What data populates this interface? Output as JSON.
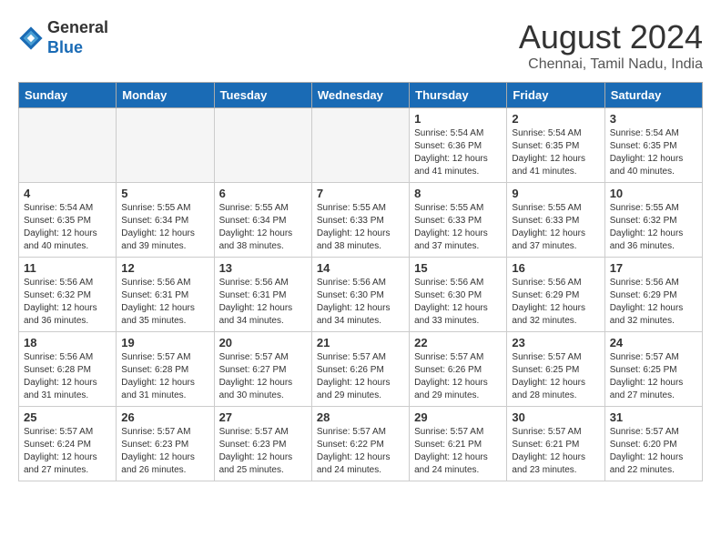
{
  "header": {
    "logo_line1": "General",
    "logo_line2": "Blue",
    "month_year": "August 2024",
    "location": "Chennai, Tamil Nadu, India"
  },
  "weekdays": [
    "Sunday",
    "Monday",
    "Tuesday",
    "Wednesday",
    "Thursday",
    "Friday",
    "Saturday"
  ],
  "weeks": [
    [
      {
        "day": "",
        "info": ""
      },
      {
        "day": "",
        "info": ""
      },
      {
        "day": "",
        "info": ""
      },
      {
        "day": "",
        "info": ""
      },
      {
        "day": "1",
        "info": "Sunrise: 5:54 AM\nSunset: 6:36 PM\nDaylight: 12 hours\nand 41 minutes."
      },
      {
        "day": "2",
        "info": "Sunrise: 5:54 AM\nSunset: 6:35 PM\nDaylight: 12 hours\nand 41 minutes."
      },
      {
        "day": "3",
        "info": "Sunrise: 5:54 AM\nSunset: 6:35 PM\nDaylight: 12 hours\nand 40 minutes."
      }
    ],
    [
      {
        "day": "4",
        "info": "Sunrise: 5:54 AM\nSunset: 6:35 PM\nDaylight: 12 hours\nand 40 minutes."
      },
      {
        "day": "5",
        "info": "Sunrise: 5:55 AM\nSunset: 6:34 PM\nDaylight: 12 hours\nand 39 minutes."
      },
      {
        "day": "6",
        "info": "Sunrise: 5:55 AM\nSunset: 6:34 PM\nDaylight: 12 hours\nand 38 minutes."
      },
      {
        "day": "7",
        "info": "Sunrise: 5:55 AM\nSunset: 6:33 PM\nDaylight: 12 hours\nand 38 minutes."
      },
      {
        "day": "8",
        "info": "Sunrise: 5:55 AM\nSunset: 6:33 PM\nDaylight: 12 hours\nand 37 minutes."
      },
      {
        "day": "9",
        "info": "Sunrise: 5:55 AM\nSunset: 6:33 PM\nDaylight: 12 hours\nand 37 minutes."
      },
      {
        "day": "10",
        "info": "Sunrise: 5:55 AM\nSunset: 6:32 PM\nDaylight: 12 hours\nand 36 minutes."
      }
    ],
    [
      {
        "day": "11",
        "info": "Sunrise: 5:56 AM\nSunset: 6:32 PM\nDaylight: 12 hours\nand 36 minutes."
      },
      {
        "day": "12",
        "info": "Sunrise: 5:56 AM\nSunset: 6:31 PM\nDaylight: 12 hours\nand 35 minutes."
      },
      {
        "day": "13",
        "info": "Sunrise: 5:56 AM\nSunset: 6:31 PM\nDaylight: 12 hours\nand 34 minutes."
      },
      {
        "day": "14",
        "info": "Sunrise: 5:56 AM\nSunset: 6:30 PM\nDaylight: 12 hours\nand 34 minutes."
      },
      {
        "day": "15",
        "info": "Sunrise: 5:56 AM\nSunset: 6:30 PM\nDaylight: 12 hours\nand 33 minutes."
      },
      {
        "day": "16",
        "info": "Sunrise: 5:56 AM\nSunset: 6:29 PM\nDaylight: 12 hours\nand 32 minutes."
      },
      {
        "day": "17",
        "info": "Sunrise: 5:56 AM\nSunset: 6:29 PM\nDaylight: 12 hours\nand 32 minutes."
      }
    ],
    [
      {
        "day": "18",
        "info": "Sunrise: 5:56 AM\nSunset: 6:28 PM\nDaylight: 12 hours\nand 31 minutes."
      },
      {
        "day": "19",
        "info": "Sunrise: 5:57 AM\nSunset: 6:28 PM\nDaylight: 12 hours\nand 31 minutes."
      },
      {
        "day": "20",
        "info": "Sunrise: 5:57 AM\nSunset: 6:27 PM\nDaylight: 12 hours\nand 30 minutes."
      },
      {
        "day": "21",
        "info": "Sunrise: 5:57 AM\nSunset: 6:26 PM\nDaylight: 12 hours\nand 29 minutes."
      },
      {
        "day": "22",
        "info": "Sunrise: 5:57 AM\nSunset: 6:26 PM\nDaylight: 12 hours\nand 29 minutes."
      },
      {
        "day": "23",
        "info": "Sunrise: 5:57 AM\nSunset: 6:25 PM\nDaylight: 12 hours\nand 28 minutes."
      },
      {
        "day": "24",
        "info": "Sunrise: 5:57 AM\nSunset: 6:25 PM\nDaylight: 12 hours\nand 27 minutes."
      }
    ],
    [
      {
        "day": "25",
        "info": "Sunrise: 5:57 AM\nSunset: 6:24 PM\nDaylight: 12 hours\nand 27 minutes."
      },
      {
        "day": "26",
        "info": "Sunrise: 5:57 AM\nSunset: 6:23 PM\nDaylight: 12 hours\nand 26 minutes."
      },
      {
        "day": "27",
        "info": "Sunrise: 5:57 AM\nSunset: 6:23 PM\nDaylight: 12 hours\nand 25 minutes."
      },
      {
        "day": "28",
        "info": "Sunrise: 5:57 AM\nSunset: 6:22 PM\nDaylight: 12 hours\nand 24 minutes."
      },
      {
        "day": "29",
        "info": "Sunrise: 5:57 AM\nSunset: 6:21 PM\nDaylight: 12 hours\nand 24 minutes."
      },
      {
        "day": "30",
        "info": "Sunrise: 5:57 AM\nSunset: 6:21 PM\nDaylight: 12 hours\nand 23 minutes."
      },
      {
        "day": "31",
        "info": "Sunrise: 5:57 AM\nSunset: 6:20 PM\nDaylight: 12 hours\nand 22 minutes."
      }
    ]
  ]
}
